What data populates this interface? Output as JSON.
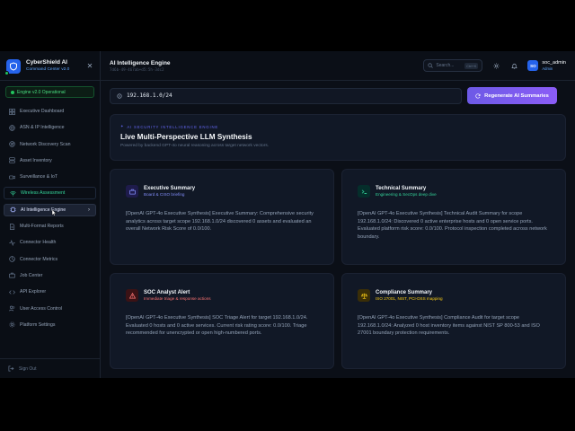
{
  "brand": {
    "title": "CyberShield AI",
    "subtitle": "Command Center v2.0",
    "engine_status": "Engine v2.0 Operational"
  },
  "sidebar": {
    "items": [
      {
        "label": "Executive Dashboard",
        "icon": "dashboard-icon"
      },
      {
        "label": "ASN & IP Intelligence",
        "icon": "globe-icon"
      },
      {
        "label": "Network Discovery Scan",
        "icon": "radar-icon"
      },
      {
        "label": "Asset Inventory",
        "icon": "server-icon"
      },
      {
        "label": "Surveillance & IoT",
        "icon": "camera-icon"
      },
      {
        "label": "Wireless Assessment",
        "icon": "wifi-icon"
      },
      {
        "label": "AI Intelligence Engine",
        "icon": "cpu-icon",
        "active": true
      },
      {
        "label": "Multi-Format Reports",
        "icon": "file-icon"
      },
      {
        "label": "Connector Health",
        "icon": "activity-icon"
      },
      {
        "label": "Connector Metrics",
        "icon": "chart-icon"
      },
      {
        "label": "Job Center",
        "icon": "briefcase-icon"
      },
      {
        "label": "API Explorer",
        "icon": "code-icon"
      },
      {
        "label": "User Access Control",
        "icon": "users-icon"
      },
      {
        "label": "Platform Settings",
        "icon": "gear-icon"
      }
    ],
    "sign_out": "Sign Out"
  },
  "topbar": {
    "title": "AI Intelligence Engine",
    "session_id": "7d6b-49-467ab+d5:5h-3dc2",
    "search_placeholder": "Search...",
    "search_shortcut": "Ctrl+K",
    "user": {
      "initials": "SO",
      "name": "soc_admin",
      "role": "Admin"
    }
  },
  "target": {
    "value": "192.168.1.0/24",
    "regenerate_label": "Regenerate AI Summaries"
  },
  "hero": {
    "eyebrow": "AI SECURITY INTELLIGENCE ENGINE",
    "title": "Live Multi-Perspective LLM Synthesis",
    "description": "Powered by backend GPT-4o neural reasoning across target network vectors."
  },
  "cards": [
    {
      "title": "Executive Summary",
      "subtitle": "Board & CISO briefing",
      "icon": "briefcase-icon",
      "accent": "#818cf8",
      "body": "[OpenAI GPT-4o Executive Synthesis] Executive Summary: Comprehensive security analytics across target scope 192.168.1.0/24 discovered 0 assets and evaluated an overall Network Risk Score of 0.0/100."
    },
    {
      "title": "Technical Summary",
      "subtitle": "Engineering & SecOps deep dive",
      "icon": "terminal-icon",
      "accent": "#34d399",
      "body": "[OpenAI GPT-4o Executive Synthesis] Technical Audit Summary for scope 192.168.1.0/24: Discovered 0 active enterprise hosts and 0 open service ports. Evaluated platform risk score: 0.0/100. Protocol inspection completed across network boundary."
    },
    {
      "title": "SOC Analyst Alert",
      "subtitle": "Immediate triage & response actions",
      "icon": "alert-triangle-icon",
      "accent": "#f87171",
      "body": "[OpenAI GPT-4o Executive Synthesis] SOC Triage Alert for target 192.168.1.0/24. Evaluated 0 hosts and 0 active services. Current risk rating score: 0.0/100. Triage recommended for unencrypted or open high-numbered ports."
    },
    {
      "title": "Compliance Summary",
      "subtitle": "ISO 27001, NIST, PCI-DSS mapping",
      "icon": "scale-icon",
      "accent": "#facc15",
      "body": "[OpenAI GPT-4o Executive Synthesis] Compliance Audit for target scope 192.168.1.0/24: Analyzed 0 host inventory items against NIST SP 800-53 and ISO 27001 boundary protection requirements."
    }
  ]
}
